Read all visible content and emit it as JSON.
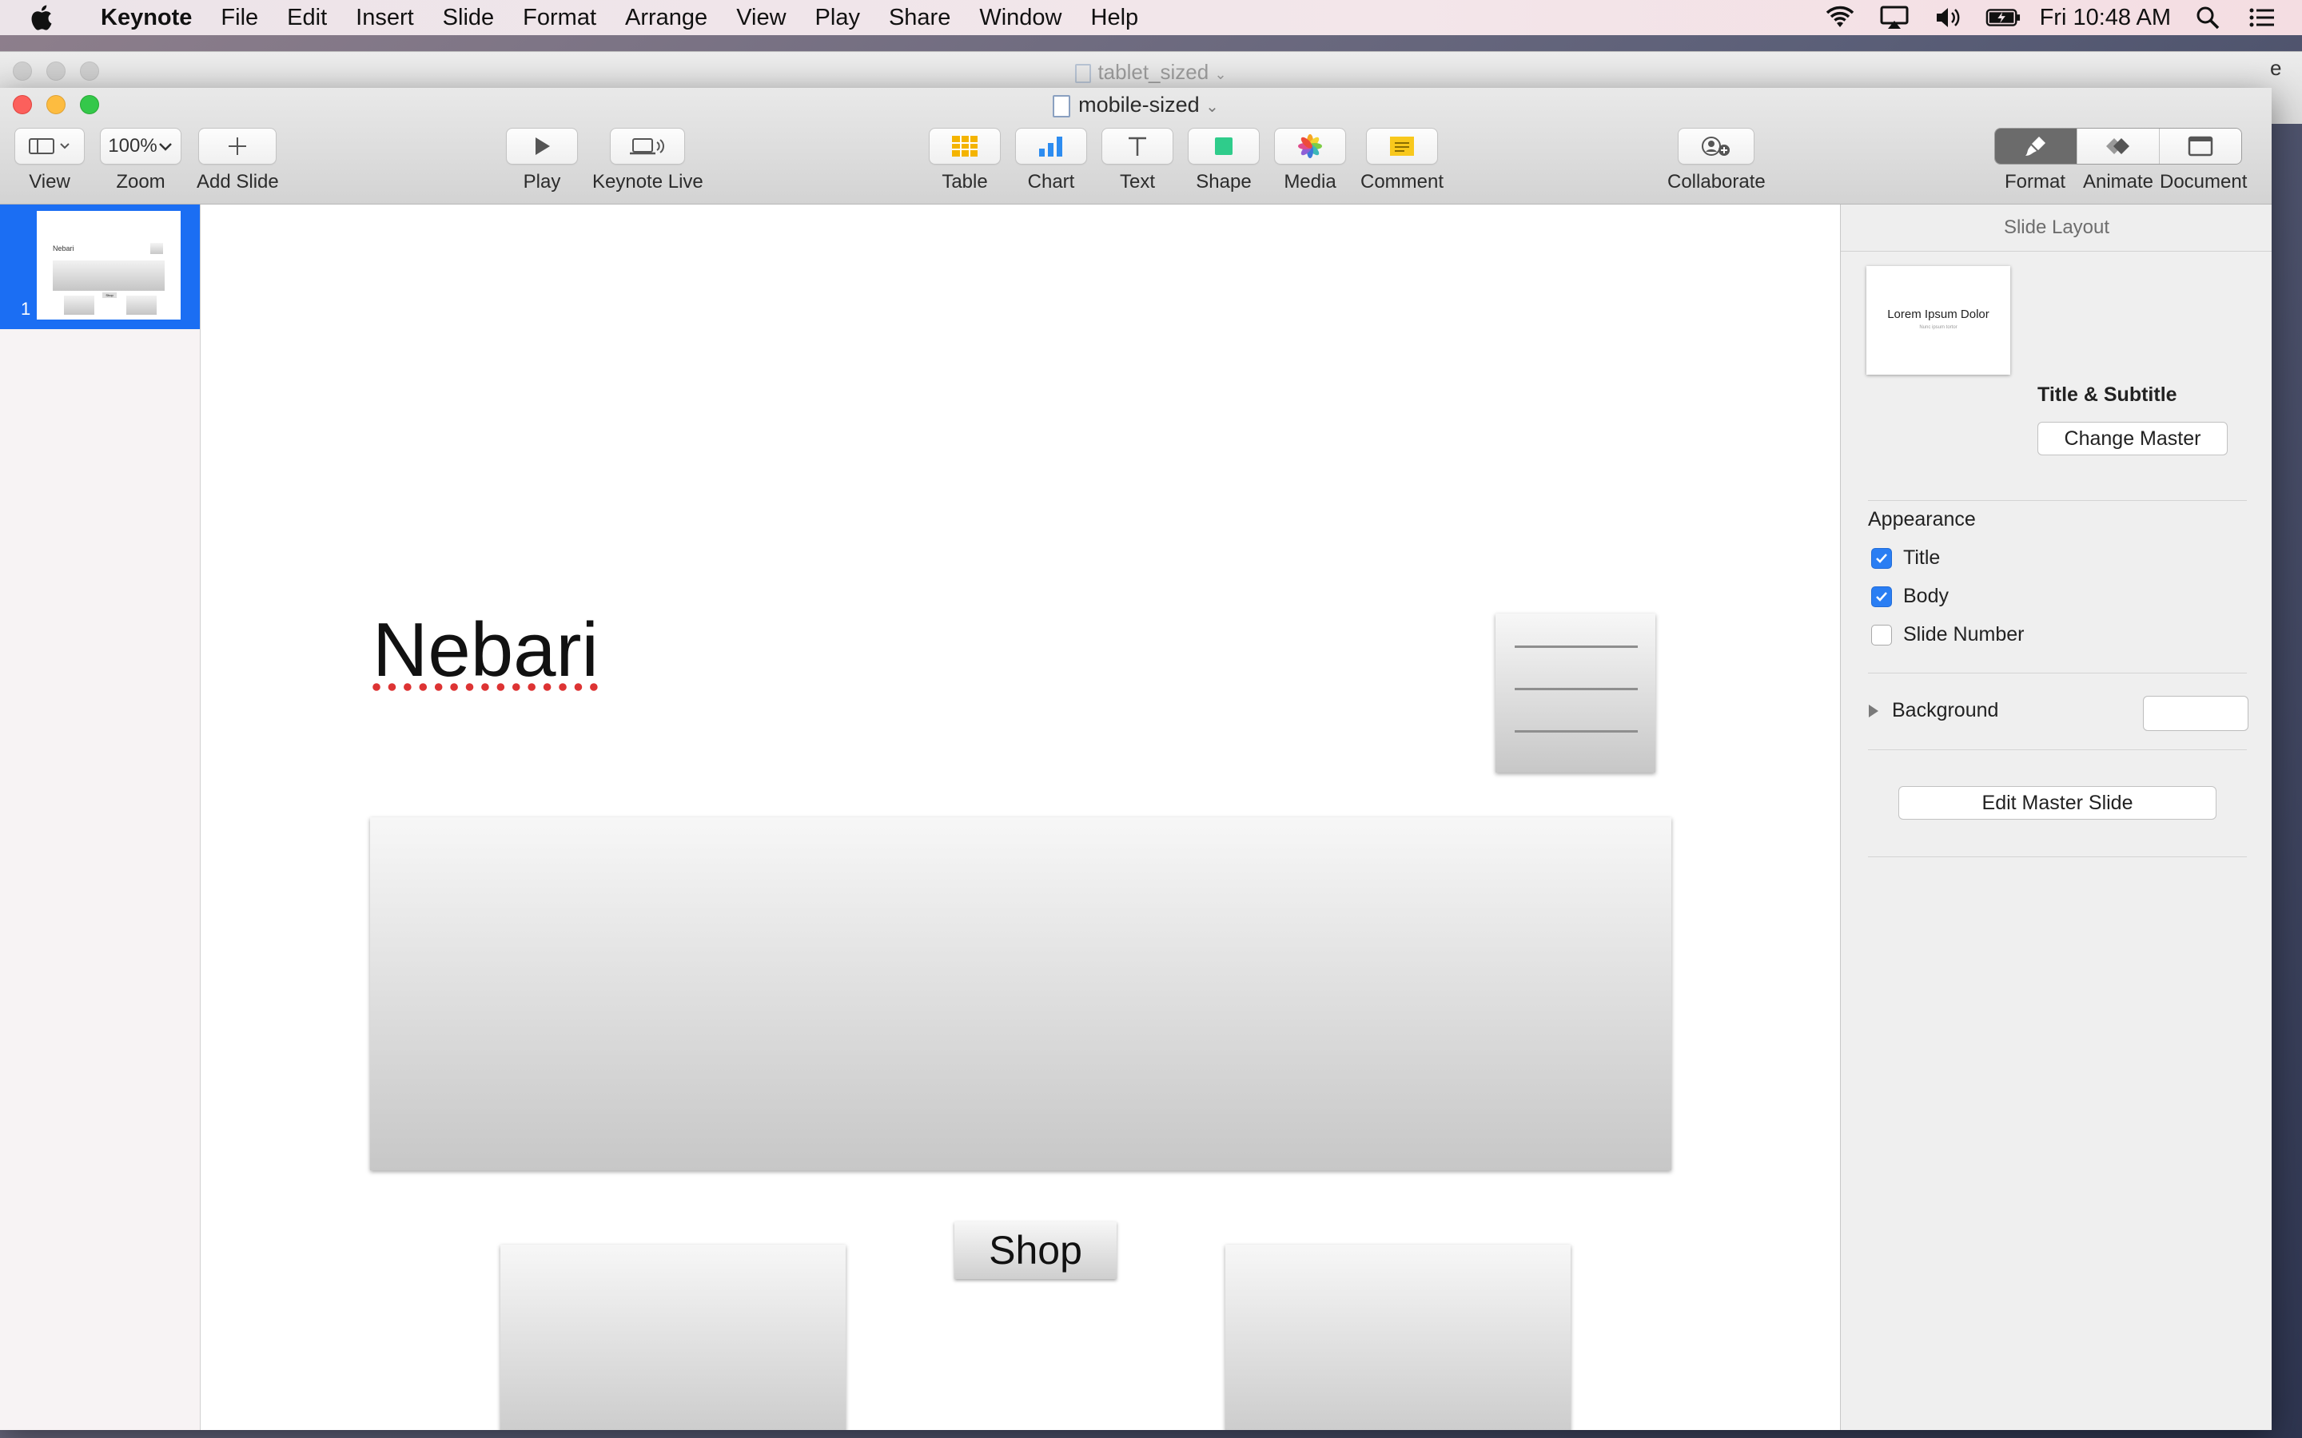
{
  "menubar": {
    "app": "Keynote",
    "items": [
      "File",
      "Edit",
      "Insert",
      "Slide",
      "Format",
      "Arrange",
      "View",
      "Play",
      "Share",
      "Window",
      "Help"
    ],
    "clock": "Fri 10:48 AM"
  },
  "back_window": {
    "title": "tablet_sized",
    "edge_char": "e"
  },
  "window": {
    "title": "mobile-sized"
  },
  "toolbar": {
    "view_label": "View",
    "zoom_value": "100%",
    "zoom_label": "Zoom",
    "add_slide_label": "Add Slide",
    "play_label": "Play",
    "keynote_live_label": "Keynote Live",
    "table_label": "Table",
    "chart_label": "Chart",
    "text_label": "Text",
    "shape_label": "Shape",
    "media_label": "Media",
    "comment_label": "Comment",
    "collaborate_label": "Collaborate",
    "format_label": "Format",
    "animate_label": "Animate",
    "document_label": "Document"
  },
  "navigator": {
    "slides": [
      {
        "number": "1",
        "thumb_title": "Nebari",
        "thumb_button": "Shop"
      }
    ]
  },
  "slide": {
    "title": "Nebari",
    "shop_label": "Shop"
  },
  "inspector": {
    "header": "Slide Layout",
    "master_thumb_title": "Lorem Ipsum Dolor",
    "master_thumb_subtitle": "Nunc ipsum tortor",
    "master_name": "Title & Subtitle",
    "change_master_label": "Change Master",
    "appearance_label": "Appearance",
    "title_check_label": "Title",
    "body_check_label": "Body",
    "slide_number_check_label": "Slide Number",
    "title_checked": true,
    "body_checked": true,
    "slide_number_checked": false,
    "background_label": "Background",
    "edit_master_label": "Edit Master Slide"
  },
  "colors": {
    "accent": "#2a7ef3",
    "selection": "#1b6ef3",
    "close": "#fc605c",
    "minimize": "#fdbc40",
    "maximize": "#34c84a"
  }
}
